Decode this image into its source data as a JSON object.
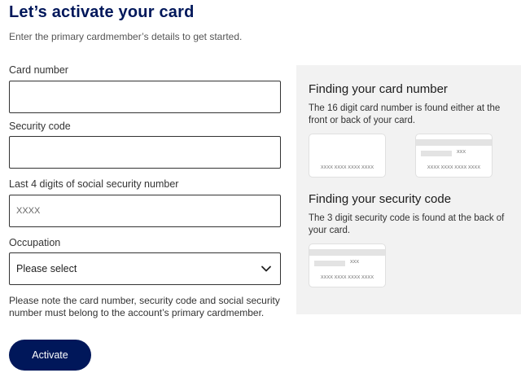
{
  "page": {
    "title": "Let’s activate your card",
    "subtitle": "Enter the primary cardmember’s details to get started."
  },
  "form": {
    "card_number_label": "Card number",
    "security_code_label": "Security code",
    "ssn_label": "Last 4 digits of social security number",
    "ssn_placeholder": "XXXX",
    "occupation_label": "Occupation",
    "occupation_selected": "Please select",
    "note": "Please note the card number, security code and social security number must belong to the account’s primary cardmember.",
    "submit_label": "Activate"
  },
  "help": {
    "card_number_heading": "Finding your card number",
    "card_number_text": "The 16 digit card number is found either at the front or back of your card.",
    "security_heading": "Finding your security code",
    "security_text": "The 3 digit security code is found at the back of your card.",
    "card_digits": "XXXX XXXX XXXX XXXX",
    "code_digits": "XXX"
  },
  "colors": {
    "brand": "#00175a",
    "panel_bg": "#f2f2f2"
  },
  "icons": {
    "select_arrow": "chevron-down-icon"
  }
}
